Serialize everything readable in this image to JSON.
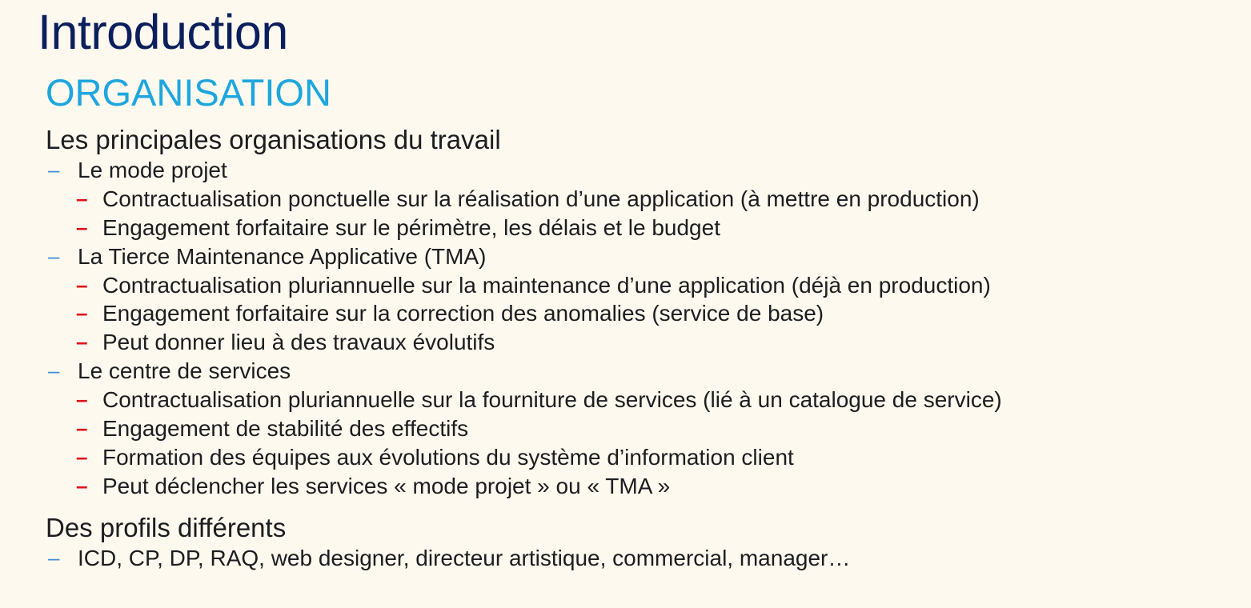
{
  "slide": {
    "title": "Introduction",
    "subtitle": "ORGANISATION",
    "section1": {
      "heading": "Les principales organisations du travail",
      "groups": [
        {
          "label": "Le mode projet",
          "items": [
            "Contractualisation ponctuelle sur la réalisation d’une application (à mettre en production)",
            "Engagement forfaitaire sur le périmètre, les délais et le budget"
          ]
        },
        {
          "label": "La Tierce Maintenance Applicative (TMA)",
          "items": [
            "Contractualisation pluriannuelle sur la maintenance d’une application (déjà en production)",
            "Engagement forfaitaire sur la correction des anomalies (service de base)",
            "Peut donner lieu à des travaux évolutifs"
          ]
        },
        {
          "label": "Le centre de services",
          "items": [
            "Contractualisation pluriannuelle sur  la fourniture de services (lié à un catalogue de service)",
            "Engagement de stabilité des effectifs",
            "Formation des équipes aux évolutions du système d’information client",
            "Peut déclencher les services « mode projet » ou « TMA »"
          ]
        }
      ]
    },
    "section2": {
      "heading": "Des profils différents",
      "items": [
        "ICD, CP, DP, RAQ, web designer, directeur artistique, commercial, manager…"
      ]
    },
    "bullet_glyph": "–"
  },
  "colors": {
    "background": "#fdf9ef",
    "title": "#0b1f5c",
    "subtitle": "#1ea6de",
    "body_text": "#1d1d1f",
    "level1_dash": "#3f8fd6",
    "level2_dash": "#e0111b"
  }
}
